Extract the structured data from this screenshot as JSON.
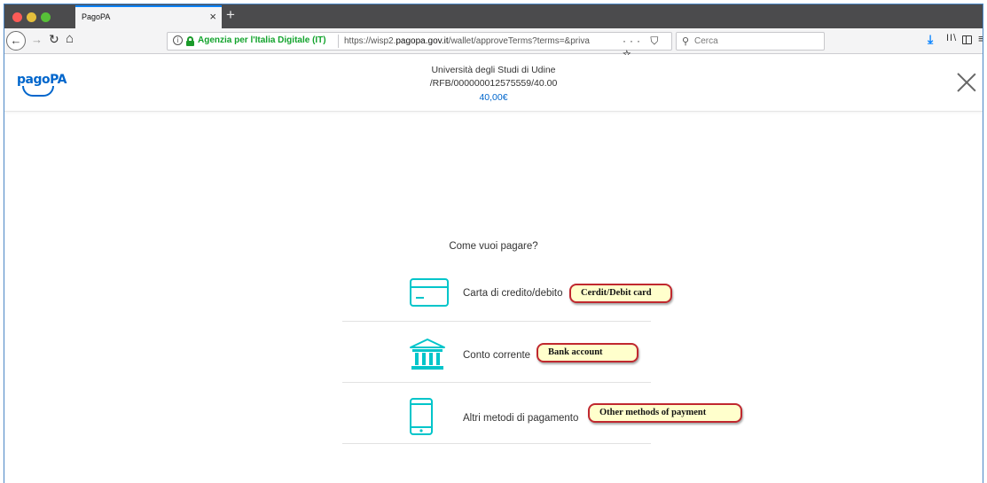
{
  "browser": {
    "tab_title": "PagoPA",
    "tab_close": "×",
    "new_tab": "+",
    "url": {
      "site_identity": "Agenzia per l'Italia Digitale (IT)",
      "prefix": "https://wisp2.",
      "domain": "pagopa.gov.it",
      "path": "/wallet/approveTerms?terms=&priva"
    },
    "page_actions": "··· ⛉ ☆",
    "search_placeholder": "Cerca",
    "icons": [
      "back-icon",
      "forward-icon",
      "reload-icon",
      "home-icon",
      "info-icon",
      "lock-icon",
      "search-icon",
      "download-icon",
      "library-icon",
      "sidebar-icon",
      "menu-icon"
    ]
  },
  "header": {
    "logo_text": "pagoPA",
    "org_name": "Università degli Studi di Udine",
    "reference": "/RFB/000000012575559/40.00",
    "amount": "40,00€",
    "accent_color": "#0066cc"
  },
  "main": {
    "question": "Come vuoi pagare?",
    "icon_color": "#00c5ca",
    "methods": [
      {
        "label": "Carta di credito/debito",
        "icon": "credit-card-icon",
        "annotation": "Cerdit/Debit card"
      },
      {
        "label": "Conto corrente",
        "icon": "bank-icon",
        "annotation": "Bank account"
      },
      {
        "label": "Altri metodi di pagamento",
        "icon": "smartphone-icon",
        "annotation": "Other methods of payment"
      }
    ]
  }
}
